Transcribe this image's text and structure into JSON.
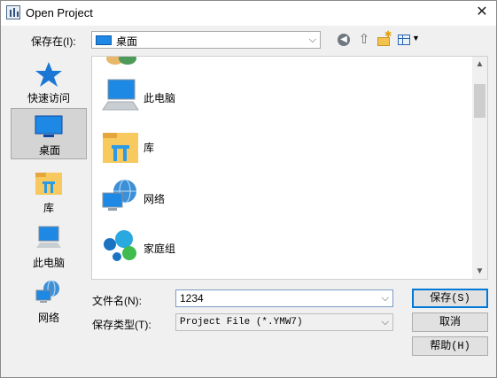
{
  "window": {
    "title": "Open Project"
  },
  "lookin": {
    "label": "保存在(I):",
    "value": "桌面"
  },
  "places": [
    {
      "label": "快速访问",
      "icon": "star-icon"
    },
    {
      "label": "桌面",
      "icon": "desktop-icon",
      "selected": true
    },
    {
      "label": "库",
      "icon": "library-icon"
    },
    {
      "label": "此电脑",
      "icon": "computer-icon"
    },
    {
      "label": "网络",
      "icon": "network-icon"
    }
  ],
  "files": [
    {
      "label": "此电脑",
      "icon": "computer-icon"
    },
    {
      "label": "库",
      "icon": "library-icon"
    },
    {
      "label": "网络",
      "icon": "network-icon"
    },
    {
      "label": "家庭组",
      "icon": "homegroup-icon"
    }
  ],
  "filename": {
    "label": "文件名(N):",
    "value": "1234"
  },
  "filetype": {
    "label": "保存类型(T):",
    "value": "Project File (*.YMW7)"
  },
  "buttons": {
    "save": "保存(S)",
    "cancel": "取消",
    "help": "帮助(H)"
  }
}
